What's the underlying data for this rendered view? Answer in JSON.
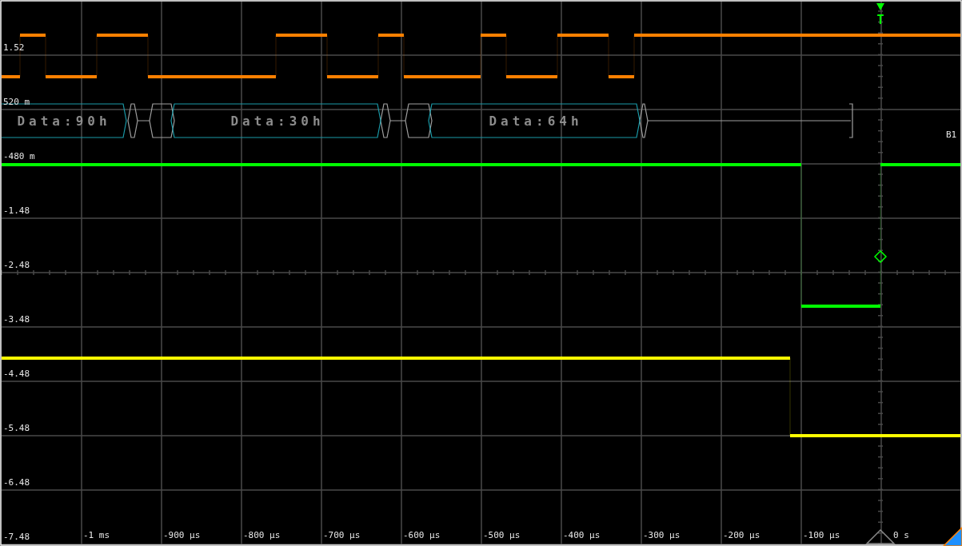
{
  "trigger": {
    "label": "T"
  },
  "y_labels": [
    "1.52",
    "520 m",
    "-480 m",
    "-1.48",
    "-2.48",
    "-3.48",
    "-4.48",
    "-5.48",
    "-6.48",
    "-7.48"
  ],
  "x_labels": [
    "-1 ms",
    "-900 µs",
    "-800 µs",
    "-700 µs",
    "-600 µs",
    "-500 µs",
    "-400 µs",
    "-300 µs",
    "-200 µs",
    "-100 µs",
    "0 s"
  ],
  "bus": {
    "name": "B1",
    "frames": [
      {
        "label": "Data:90h"
      },
      {
        "label": "Data:30h"
      },
      {
        "label": "Data:64h"
      }
    ]
  },
  "traces": [
    {
      "color": "#ff8000"
    },
    {
      "color": "#00ff00"
    },
    {
      "color": "#ffff00"
    }
  ]
}
